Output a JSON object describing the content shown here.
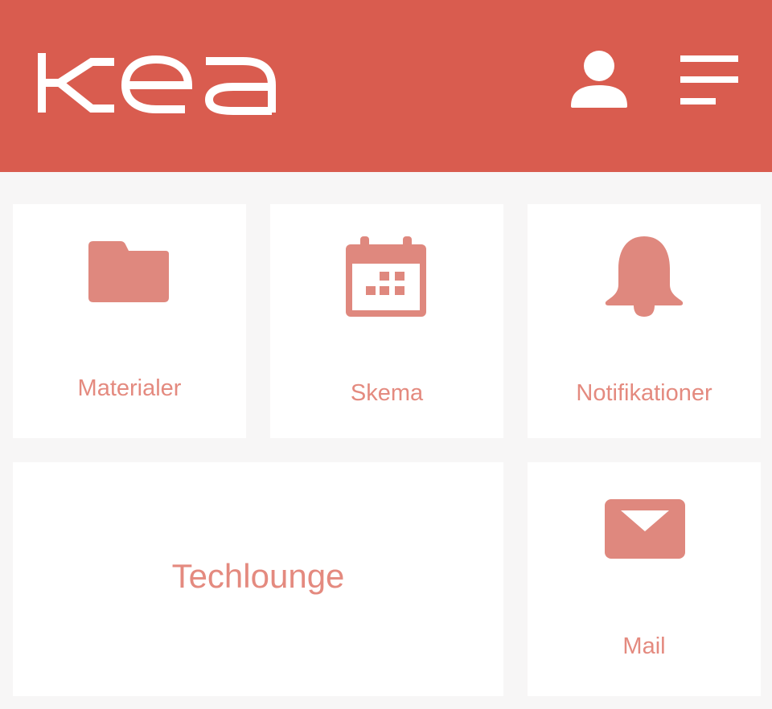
{
  "header": {
    "logo_text": "Kea",
    "background_color": "#d95c4f",
    "profile_icon": "user-icon",
    "menu_icon": "hamburger-menu-icon"
  },
  "tiles": [
    {
      "label": "Materialer",
      "icon": "folder-icon"
    },
    {
      "label": "Skema",
      "icon": "calendar-icon"
    },
    {
      "label": "Notifikationer",
      "icon": "bell-icon"
    },
    {
      "label": "Techlounge",
      "icon": ""
    },
    {
      "label": "Mail",
      "icon": "mail-icon"
    }
  ],
  "colors": {
    "accent": "#d95c4f",
    "tile_icon": "#df887e",
    "tile_text": "#e48a7f",
    "page_background": "#f7f6f6",
    "tile_background": "#ffffff"
  }
}
